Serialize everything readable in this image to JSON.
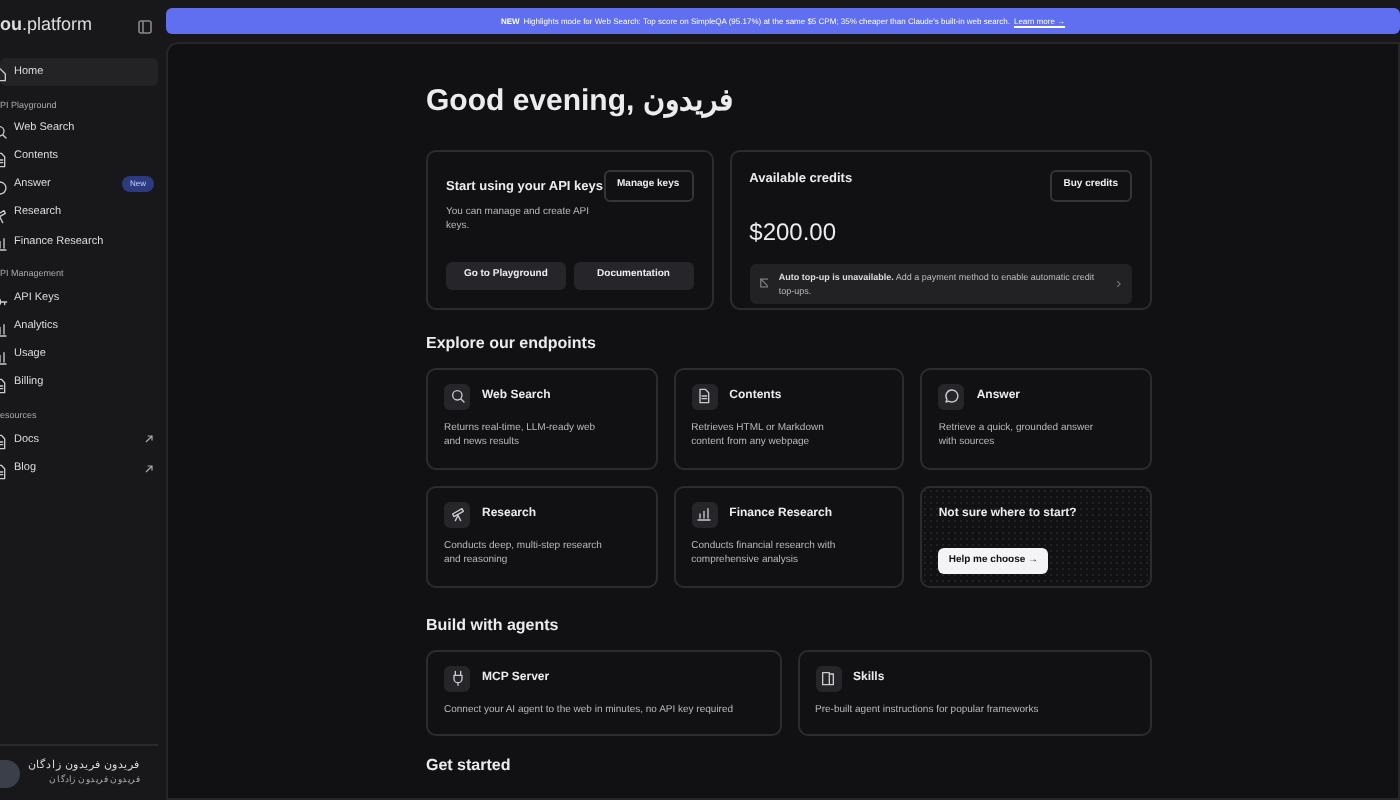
{
  "sidebar": {
    "brand": "ou.platform",
    "items": [
      {
        "kind": "item",
        "label": "Home",
        "selected": true
      },
      {
        "kind": "heading",
        "label": "PI Playground"
      },
      {
        "kind": "item",
        "label": "Web Search",
        "selected": false
      },
      {
        "kind": "item",
        "label": "Contents",
        "selected": false
      },
      {
        "kind": "item",
        "label": "Answer",
        "selected": false,
        "badge": "New"
      },
      {
        "kind": "item",
        "label": "Research",
        "selected": false
      },
      {
        "kind": "item",
        "label": "Finance Research",
        "selected": false
      },
      {
        "kind": "heading",
        "label": "PI Management"
      },
      {
        "kind": "item",
        "label": "API Keys",
        "selected": false
      },
      {
        "kind": "item",
        "label": "Analytics",
        "selected": false
      },
      {
        "kind": "item",
        "label": "Usage",
        "selected": false
      },
      {
        "kind": "item",
        "label": "Billing",
        "selected": false
      },
      {
        "kind": "heading",
        "label": "esources"
      },
      {
        "kind": "item",
        "label": "Docs",
        "selected": false,
        "external": true
      },
      {
        "kind": "item",
        "label": "Blog",
        "selected": false,
        "external": true
      }
    ],
    "user": {
      "name": "فریدون فریدون زادگان",
      "subtitle": "فریدون فریدون زادگان"
    }
  },
  "banner": {
    "tag": "NEW",
    "text": "Highlights mode for Web Search: Top score on SimpleQA (95.17%) at the same $5 CPM; 35% cheaper than Claude's built-in web search.",
    "link": "Learn more →"
  },
  "greeting": "Good evening, فریدون",
  "api_card": {
    "title": "Start using your API keys",
    "description": "You can manage and create API keys.",
    "button": "Manage keys",
    "actions": [
      "Go to Playground",
      "Documentation"
    ]
  },
  "credits_card": {
    "title": "Available credits",
    "button": "Buy credits",
    "amount": "$200.00",
    "notice": "**Auto top-up is unavailable.** Add a payment method to enable automatic credit top-ups."
  },
  "endpoints": {
    "heading": "Explore our endpoints",
    "cards": [
      {
        "kind": "endpoint",
        "title": "Web Search",
        "description": "Returns real-time, LLM-ready web and news results"
      },
      {
        "kind": "endpoint",
        "title": "Contents",
        "description": "Retrieves HTML or Markdown content from any webpage"
      },
      {
        "kind": "endpoint",
        "title": "Answer",
        "description": "Retrieve a quick, grounded answer with sources"
      },
      {
        "kind": "endpoint",
        "title": "Research",
        "description": "Conducts deep, multi-step research and reasoning"
      },
      {
        "kind": "endpoint",
        "title": "Finance Research",
        "description": "Conducts financial research with comprehensive analysis"
      },
      {
        "kind": "help",
        "title": "Not sure where to start?",
        "button": "Help me choose →"
      }
    ]
  },
  "agents": {
    "heading": "Build with agents",
    "cards": [
      {
        "title": "MCP Server",
        "description": "Connect your AI agent to the web in minutes, no API key required"
      },
      {
        "title": "Skills",
        "description": "Pre-built agent instructions for popular frameworks"
      }
    ]
  },
  "next_heading": "Get started"
}
